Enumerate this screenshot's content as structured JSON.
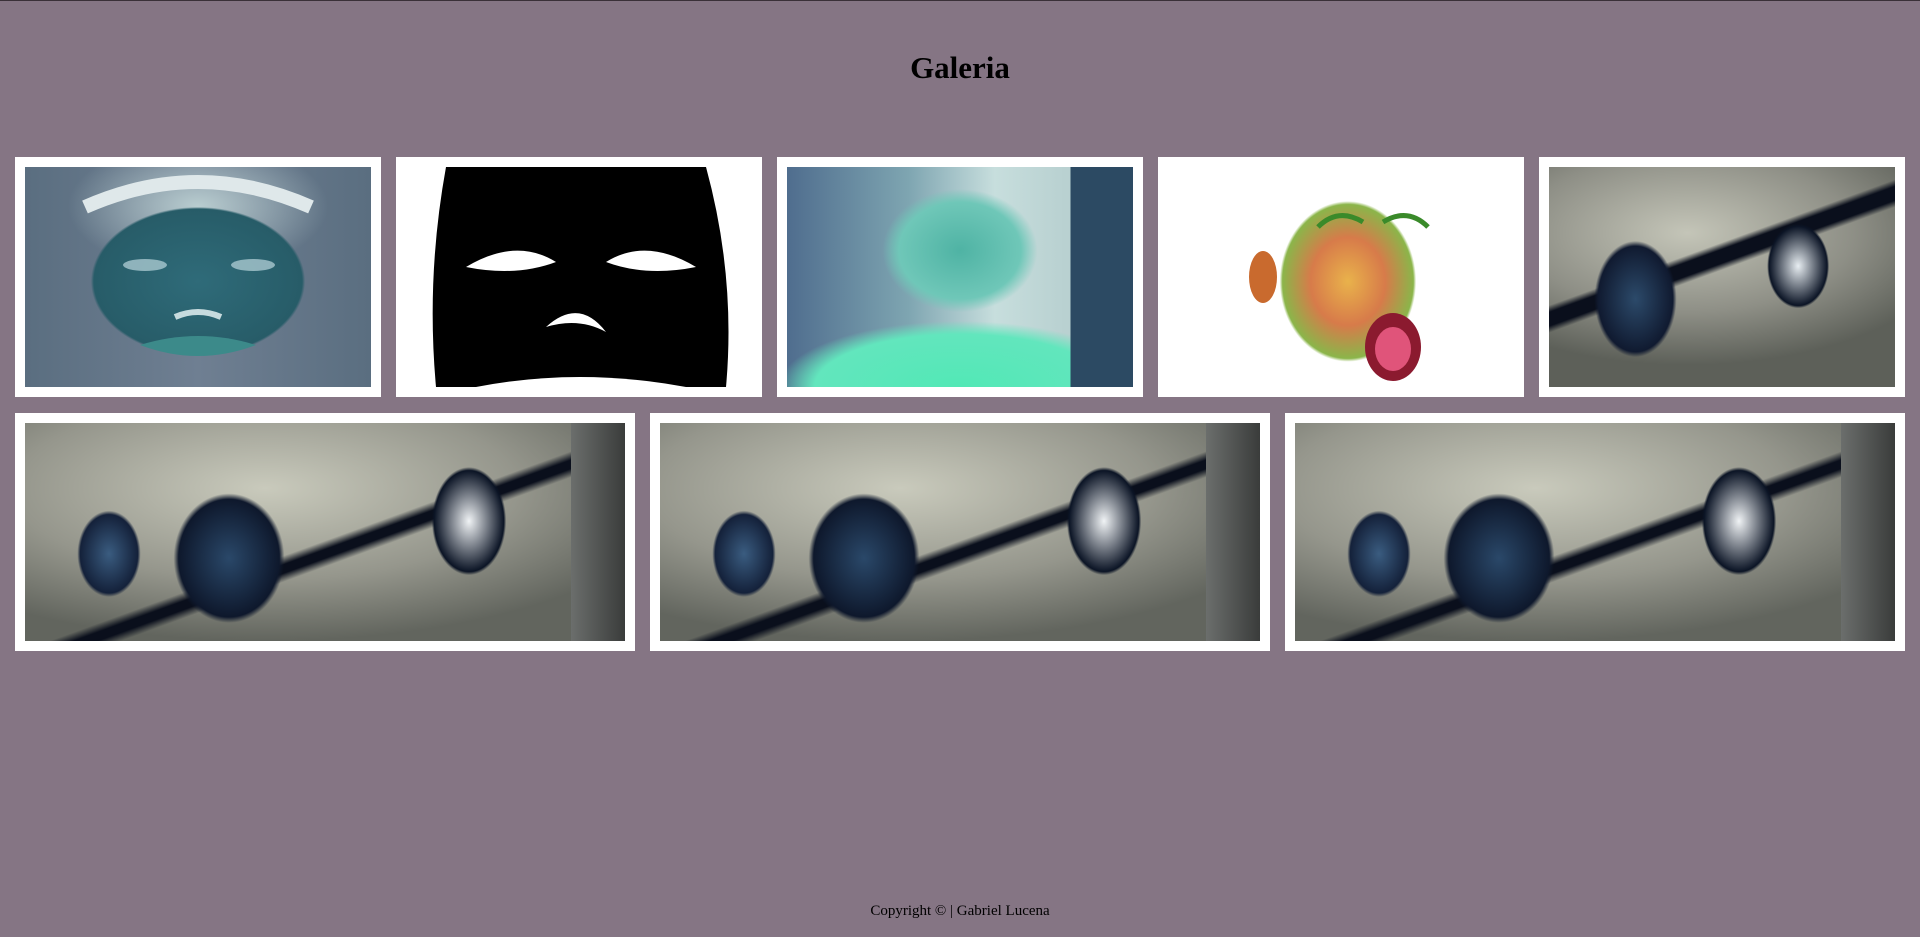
{
  "page": {
    "title": "Galeria",
    "background_color": "#857584"
  },
  "gallery": {
    "row1": [
      {
        "name": "gallery-image-1",
        "description_icon": "inverted-face-teal"
      },
      {
        "name": "gallery-image-2",
        "description_icon": "threshold-face-black-white"
      },
      {
        "name": "gallery-image-3",
        "description_icon": "inverted-photo-person-cyan"
      },
      {
        "name": "gallery-image-4",
        "description_icon": "rainbow-shaded-face-shouting"
      },
      {
        "name": "gallery-image-5",
        "description_icon": "inverted-anime-artwork"
      }
    ],
    "row2": [
      {
        "name": "gallery-image-6",
        "description_icon": "inverted-anime-artwork"
      },
      {
        "name": "gallery-image-7",
        "description_icon": "inverted-anime-artwork"
      },
      {
        "name": "gallery-image-8",
        "description_icon": "inverted-anime-artwork"
      }
    ]
  },
  "footer": {
    "copyright": "Copyright © | Gabriel Lucena"
  }
}
